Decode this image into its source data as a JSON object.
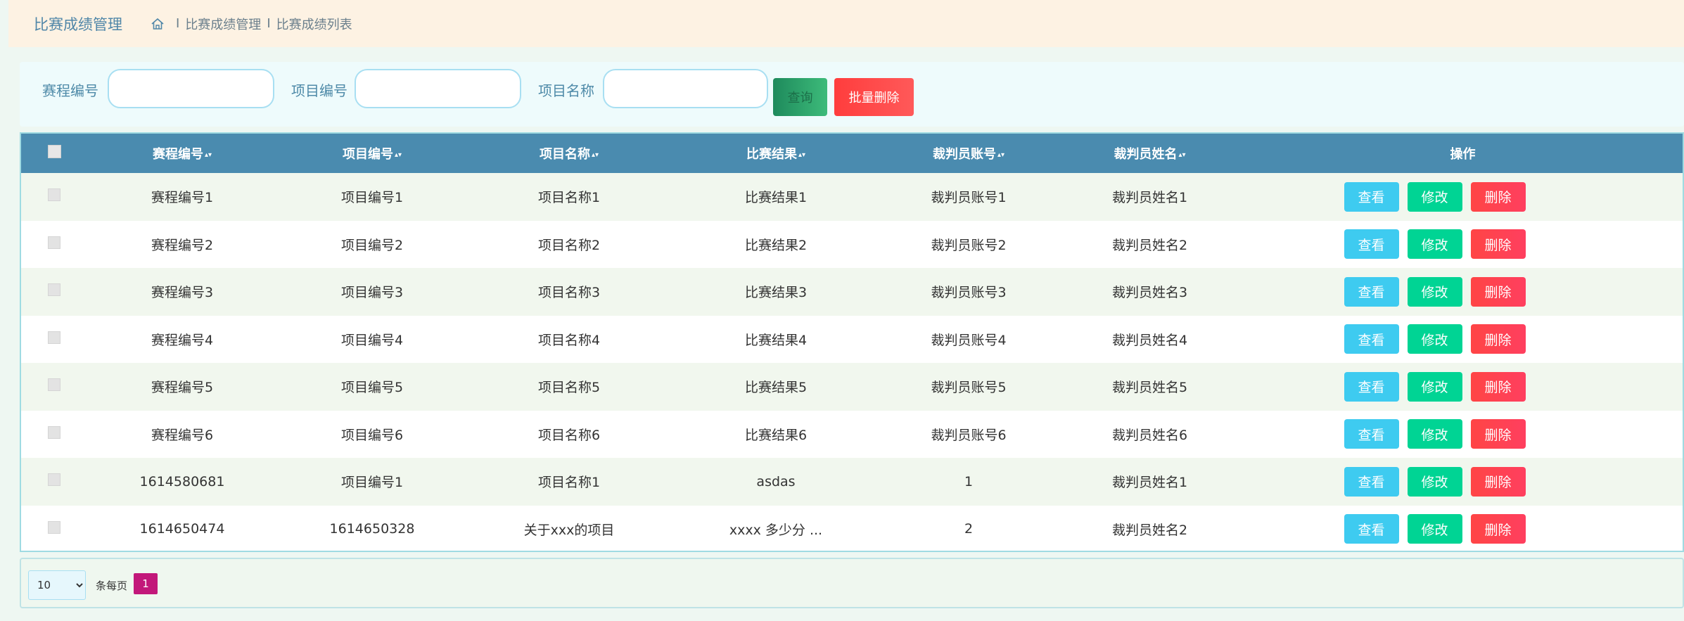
{
  "header": {
    "module_title": "比赛成绩管理",
    "breadcrumb": [
      "比赛成绩管理",
      "比赛成绩列表"
    ],
    "separator": "I"
  },
  "search": {
    "fields": [
      {
        "label": "赛程编号",
        "value": "",
        "placeholder": ""
      },
      {
        "label": "项目编号",
        "value": "",
        "placeholder": ""
      },
      {
        "label": "项目名称",
        "value": "",
        "placeholder": ""
      }
    ],
    "query_label": "查询",
    "batch_delete_label": "批量删除"
  },
  "table": {
    "columns": [
      "赛程编号",
      "项目编号",
      "项目名称",
      "比赛结果",
      "裁判员账号",
      "裁判员姓名",
      "操作"
    ],
    "rows": [
      {
        "schedule_no": "赛程编号1",
        "project_no": "项目编号1",
        "project_name": "项目名称1",
        "result": "比赛结果1",
        "referee_account": "裁判员账号1",
        "referee_name": "裁判员姓名1"
      },
      {
        "schedule_no": "赛程编号2",
        "project_no": "项目编号2",
        "project_name": "项目名称2",
        "result": "比赛结果2",
        "referee_account": "裁判员账号2",
        "referee_name": "裁判员姓名2"
      },
      {
        "schedule_no": "赛程编号3",
        "project_no": "项目编号3",
        "project_name": "项目名称3",
        "result": "比赛结果3",
        "referee_account": "裁判员账号3",
        "referee_name": "裁判员姓名3"
      },
      {
        "schedule_no": "赛程编号4",
        "project_no": "项目编号4",
        "project_name": "项目名称4",
        "result": "比赛结果4",
        "referee_account": "裁判员账号4",
        "referee_name": "裁判员姓名4"
      },
      {
        "schedule_no": "赛程编号5",
        "project_no": "项目编号5",
        "project_name": "项目名称5",
        "result": "比赛结果5",
        "referee_account": "裁判员账号5",
        "referee_name": "裁判员姓名5"
      },
      {
        "schedule_no": "赛程编号6",
        "project_no": "项目编号6",
        "project_name": "项目名称6",
        "result": "比赛结果6",
        "referee_account": "裁判员账号6",
        "referee_name": "裁判员姓名6"
      },
      {
        "schedule_no": "1614580681",
        "project_no": "项目编号1",
        "project_name": "项目名称1",
        "result": "asdas",
        "referee_account": "1",
        "referee_name": "裁判员姓名1"
      },
      {
        "schedule_no": "1614650474",
        "project_no": "1614650328",
        "project_name": "关于xxx的项目",
        "result": "xxxx 多少分 ...",
        "referee_account": "2",
        "referee_name": "裁判员姓名2"
      }
    ],
    "actions": {
      "view": "查看",
      "edit": "修改",
      "delete": "删除"
    }
  },
  "pagination": {
    "page_size": "10",
    "per_page_label": "条每页",
    "current_page": "1"
  },
  "colors": {
    "header_bg": "#fdf2e3",
    "table_header": "#4a8baf",
    "view_button": "#3ecbf0",
    "edit_button": "#00d494",
    "delete_button": "#ff4545",
    "current_page": "#c2187a"
  }
}
